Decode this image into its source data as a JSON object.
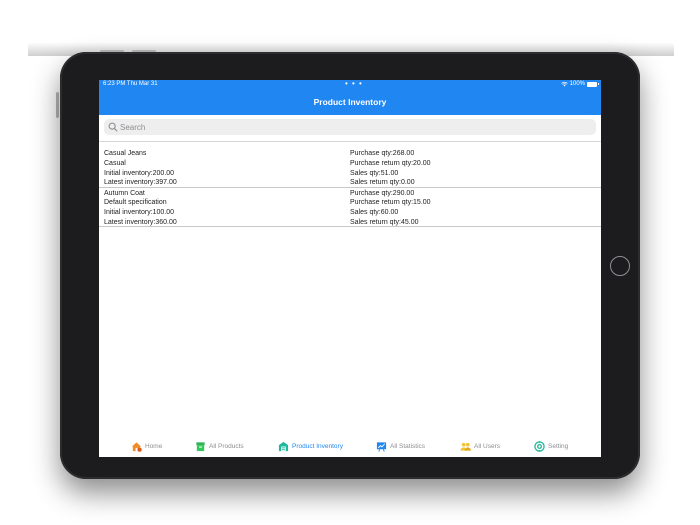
{
  "status_bar": {
    "time": "6:23 PM  Thu Mar 31",
    "dots": "• • •",
    "battery": "100%"
  },
  "header": {
    "title": "Product Inventory"
  },
  "search": {
    "placeholder": "Search"
  },
  "products": [
    {
      "name": "Casual Jeans",
      "spec": "Casual",
      "initial": "Initial inventory:200.00",
      "latest": "Latest inventory:397.00",
      "purchase": "Purchase qty:268.00",
      "purchase_return": "Purchase return qty:20.00",
      "sales": "Sales qty:51.00",
      "sales_return": "Sales return qty:0.00"
    },
    {
      "name": "Autumn Coat",
      "spec": "Default specification",
      "initial": "Initial inventory:100.00",
      "latest": "Latest inventory:360.00",
      "purchase": "Purchase qty:290.00",
      "purchase_return": "Purchase return qty:15.00",
      "sales": "Sales qty:60.00",
      "sales_return": "Sales return qty:45.00"
    }
  ],
  "tabs": [
    {
      "label": "Home",
      "icon": "home-icon",
      "color": "#f28c28"
    },
    {
      "label": "All Products",
      "icon": "box-icon",
      "color": "#34c759"
    },
    {
      "label": "Product Inventory",
      "icon": "warehouse-icon",
      "color": "#1fb89a",
      "active": true
    },
    {
      "label": "All Statistics",
      "icon": "chart-icon",
      "color": "#1f86f2"
    },
    {
      "label": "All Users",
      "icon": "users-icon",
      "color": "#f2c230"
    },
    {
      "label": "Setting",
      "icon": "gear-icon",
      "color": "#1fb89a"
    }
  ],
  "colors": {
    "accent": "#1f86f2",
    "tab_inactive": "#8e8e93"
  }
}
